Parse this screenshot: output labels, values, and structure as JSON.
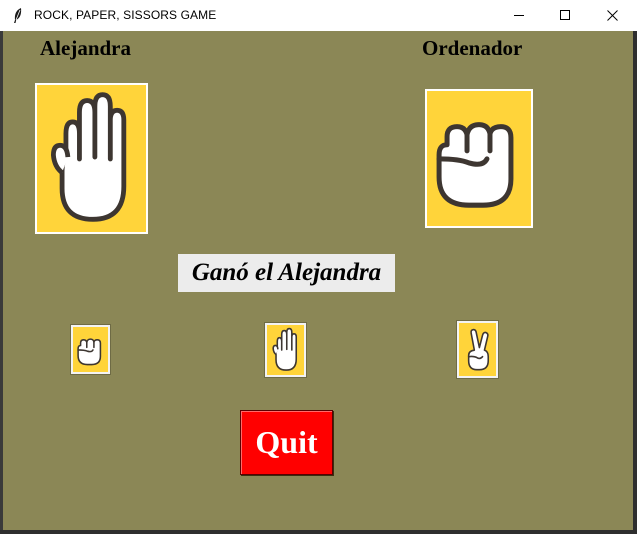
{
  "window": {
    "title": "ROCK, PAPER, SISSORS GAME",
    "app_icon": "feather-icon",
    "controls": [
      "minimize-icon",
      "maximize-icon",
      "close-icon"
    ]
  },
  "game": {
    "player_name": "Alejandra",
    "computer_name": "Ordenador",
    "player_choice": "paper-hand-icon",
    "computer_choice": "rock-fist-icon",
    "result_text": "Ganó el Alejandra"
  },
  "choices": [
    {
      "name": "rock",
      "icon": "rock-fist-icon"
    },
    {
      "name": "paper",
      "icon": "paper-hand-icon"
    },
    {
      "name": "scissors",
      "icon": "scissors-hand-icon"
    }
  ],
  "quit_button": {
    "label": "Quit"
  },
  "colors": {
    "background": "#8b8756",
    "card": "#ffd43a",
    "result_bg": "#ececec",
    "quit": "#ff0000"
  }
}
